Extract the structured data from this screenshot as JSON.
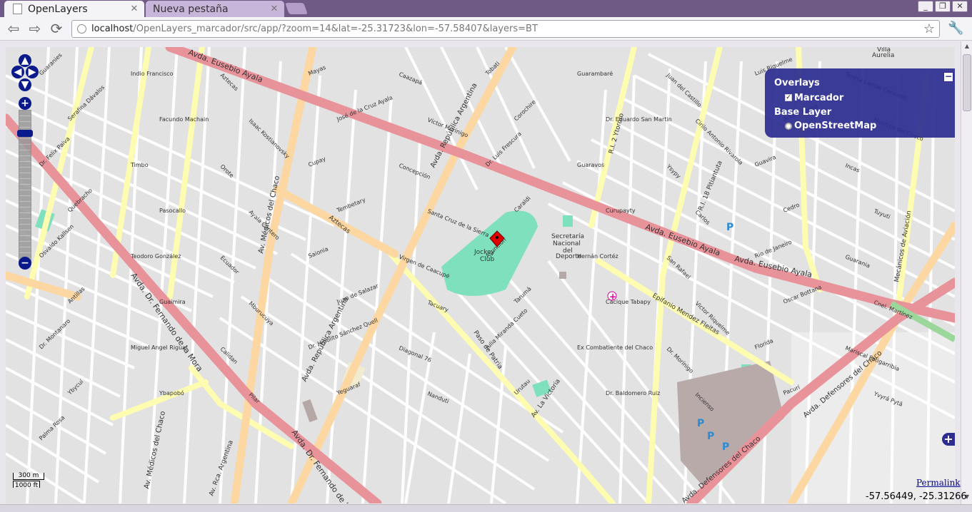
{
  "browser": {
    "tabs": [
      {
        "label": "OpenLayers",
        "active": true
      },
      {
        "label": "Nueva pestaña",
        "active": false
      }
    ],
    "close_glyph": "✕",
    "window_buttons": [
      "_",
      "❐",
      "✕"
    ],
    "url_host": "localhost",
    "url_path": "/OpenLayers_marcador/src/app/?zoom=14&lat=-25.31723&lon=-57.58407&layers=BT",
    "nav_icons": {
      "back": "back-arrow-icon",
      "forward": "forward-arrow-icon",
      "reload": "reload-icon",
      "star": "bookmark-star-icon",
      "wrench": "wrench-icon"
    }
  },
  "map": {
    "layer_switcher": {
      "overlays_title": "Overlays",
      "overlay_item": "Marcador",
      "base_title": "Base Layer",
      "base_item": "OpenStreetMap"
    },
    "scale": {
      "top": "300 m",
      "bottom": "1000 ft"
    },
    "permalink": "Permalink",
    "mouse_position": "-57.56449, -25.31266",
    "marker_name": "marker-icon",
    "colors": {
      "primary_road": "#e8929a",
      "secondary_road": "#fdd7a1",
      "tertiary_road": "#fdfcb0",
      "park": "#7fe0bd",
      "layer_switcher_bg": "#2c2c91",
      "control_blue": "#0a1a8a"
    },
    "labels": {
      "poi": [
        "Jockey",
        "Club",
        "Secretaría",
        "Nacional",
        "del",
        "Deporte",
        "Villa",
        "Aurelia"
      ],
      "main_roads": [
        "Avda. Eusebio Ayala",
        "Avda. Eusebio Ayala",
        "Avda. Eusebio Ayala",
        "Avda. República Argentina",
        "Avda. República Argentina",
        "Av. Médicos del Chaco",
        "Av. Médicos del Chaco",
        "Avda. Dr. Fernando de la Mora",
        "Avda. Dr. Fernando de la Mora",
        "Avda. Defensores del Chaco",
        "Avda. Defensores del Chaco",
        "Av. La Victoria",
        "Aztecas",
        "Paso de Patria",
        "Epifanio Mendez Fleitas",
        "R.I. 2 Ytororo",
        "R.I. 18 Pitiantuta",
        "Mecánicos de Aviación",
        "Av. Rca. Argentina"
      ],
      "streets": [
        "Guaranies",
        "Indio Francisco",
        "Aztecas",
        "Mayas",
        "Caazapá",
        "Tobati",
        "Guarambaré",
        "Juan del Castillo",
        "Luis Riquelme",
        "Teresa Lamas Carisimo",
        "Serafina Dávalos",
        "Facundo Machain",
        "Isaac Kostianovsky",
        "José de la Cruz Ayala",
        "Víctor Morinigo",
        "Corochire",
        "Dr. Eduardo San Martin",
        "Cirilo Antonio Rivarola",
        "Arturo Alsina",
        "Musicos del Chaco",
        "Dr. Felix Paiva",
        "Timbo",
        "Orote",
        "Cupay",
        "Concepción",
        "Dr. Luis Frescura",
        "Guaravos",
        "Ysypy",
        "Guavira",
        "Incas",
        "Quebracho",
        "Pasocallo",
        "Ayala Cantero",
        "Tembetary",
        "Santa Cruz de la Sierra",
        "Caraldi",
        "Curupayty",
        "Carlos",
        "Cedro",
        "Tuyuti",
        "Osvaldo Kallsen",
        "Teodoro González",
        "Ecuador",
        "Saionia",
        "Virgen de Caacupé",
        "Asunción",
        "Hernán Cortéz",
        "San Rafael",
        "Rio de Janeiro",
        "Guarania",
        "Antillas",
        "Guaimira",
        "Mburucuya",
        "Juan de Salazar",
        "Tacuary",
        "Tarumá",
        "Cacique Tabapy",
        "Victor Riquelme",
        "Oscar Bottana",
        "Cnel. Martínez",
        "Dr. Montanaro",
        "Miguel Angel Rigual",
        "Calidan",
        "Dr. Hipólito Sánchez Quell",
        "Diagonal 76",
        "Julia Miranda Cueto",
        "Ex Combatiente del Chaco",
        "Dr. Morínigo",
        "Florida",
        "Mariscal Estigarribia",
        "Ybycuí",
        "Ybapobó",
        "Pilar",
        "Yeguaraf",
        "Nanduti",
        "Urutau",
        "Dr. Baldomero Ruiz",
        "Incienso",
        "Pacurí",
        "Yvyrá Pytã",
        "Palma Rosa"
      ]
    }
  }
}
